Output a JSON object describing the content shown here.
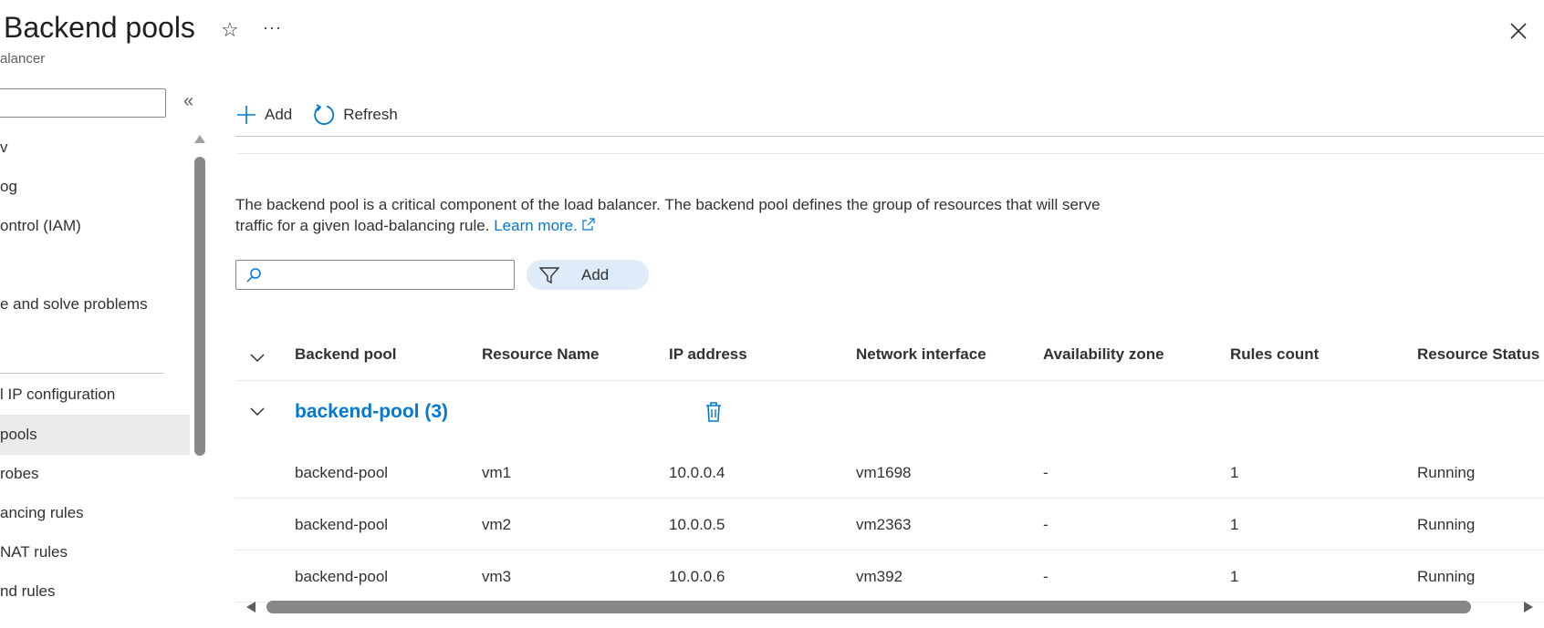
{
  "header": {
    "title": "Backend pools",
    "subtitle": "alancer",
    "more_label": "···"
  },
  "sidebar": {
    "items": [
      {
        "label": "v",
        "selected": false
      },
      {
        "label": "og",
        "selected": false
      },
      {
        "label": "ontrol (IAM)",
        "selected": false
      },
      {
        "label": "e and solve problems",
        "selected": false
      },
      {
        "label": "l IP configuration",
        "selected": false
      },
      {
        "label": " pools",
        "selected": true
      },
      {
        "label": "robes",
        "selected": false
      },
      {
        "label": "ancing rules",
        "selected": false
      },
      {
        "label": " NAT rules",
        "selected": false
      },
      {
        "label": "nd rules",
        "selected": false
      }
    ]
  },
  "toolbar": {
    "add_label": "Add",
    "refresh_label": "Refresh"
  },
  "description": {
    "text": "The backend pool is a critical component of the load balancer. The backend pool defines the group of resources that will serve traffic for a given load-balancing rule.",
    "link": "Learn more."
  },
  "filter": {
    "search_placeholder": "",
    "add_filter_label": "Add"
  },
  "grid": {
    "columns": [
      "Backend pool",
      "Resource Name",
      "IP address",
      "Network interface",
      "Availability zone",
      "Rules count",
      "Resource Status"
    ],
    "group": {
      "title": "backend-pool (3)"
    },
    "rows": [
      [
        "backend-pool",
        "vm1",
        "10.0.0.4",
        "vm1698",
        "-",
        "1",
        "Running"
      ],
      [
        "backend-pool",
        "vm2",
        "10.0.0.5",
        "vm2363",
        "-",
        "1",
        "Running"
      ],
      [
        "backend-pool",
        "vm3",
        "10.0.0.6",
        "vm392",
        "-",
        "1",
        "Running"
      ]
    ]
  },
  "colors": {
    "accent": "#0078d4",
    "selected_bg": "#edebe9",
    "pill_bg": "#deecf9"
  }
}
